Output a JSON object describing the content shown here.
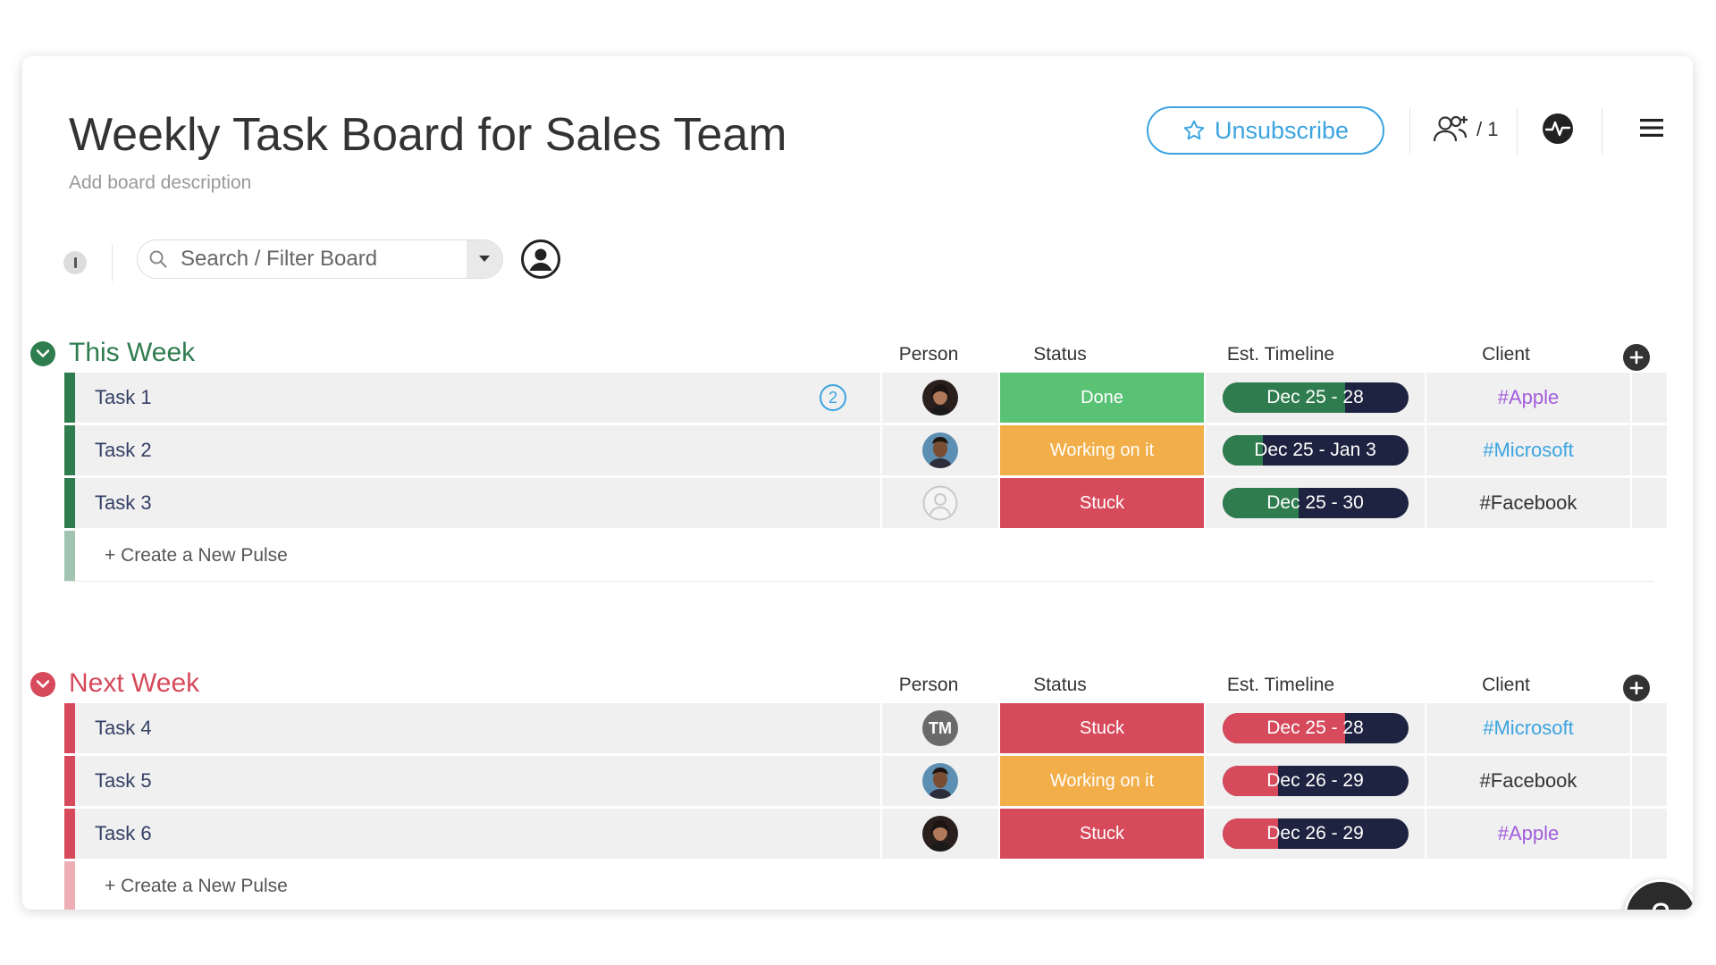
{
  "board": {
    "title": "Weekly Task Board for Sales Team",
    "description": "Add board description",
    "unsubscribe_label": "Unsubscribe",
    "members_count": "/ 1"
  },
  "toolbar": {
    "search_placeholder": "Search / Filter Board"
  },
  "columns": {
    "person": "Person",
    "status": "Status",
    "timeline": "Est. Timeline",
    "client": "Client"
  },
  "groups": [
    {
      "title": "This Week",
      "color": "#2f7d4f",
      "create_label": "+ Create a New Pulse",
      "rows": [
        {
          "name": "Task 1",
          "updates": "2",
          "person": "photo-woman",
          "status": "Done",
          "status_color": "#5ac274",
          "timeline": "Dec 25 - 28",
          "timeline_progress": 0.66,
          "client": "#Apple",
          "client_color": "#a25ddc"
        },
        {
          "name": "Task 2",
          "updates": "",
          "person": "photo-man",
          "status": "Working on it",
          "status_color": "#f2ae49",
          "timeline": "Dec 25 - Jan 3",
          "timeline_progress": 0.22,
          "client": "#Microsoft",
          "client_color": "#3ba4e0"
        },
        {
          "name": "Task 3",
          "updates": "",
          "person": "empty",
          "status": "Stuck",
          "status_color": "#d64a5c",
          "timeline": "Dec 25 - 30",
          "timeline_progress": 0.41,
          "client": "#Facebook",
          "client_color": "#333333"
        }
      ]
    },
    {
      "title": "Next Week",
      "color": "#d64a5c",
      "create_label": "+ Create a New Pulse",
      "rows": [
        {
          "name": "Task 4",
          "updates": "",
          "person": "initials",
          "initials": "TM",
          "status": "Stuck",
          "status_color": "#d64a5c",
          "timeline": "Dec 25 - 28",
          "timeline_progress": 0.66,
          "client": "#Microsoft",
          "client_color": "#3ba4e0"
        },
        {
          "name": "Task 5",
          "updates": "",
          "person": "photo-man",
          "status": "Working on it",
          "status_color": "#f2ae49",
          "timeline": "Dec 26 - 29",
          "timeline_progress": 0.3,
          "client": "#Facebook",
          "client_color": "#333333"
        },
        {
          "name": "Task 6",
          "updates": "",
          "person": "photo-woman",
          "status": "Stuck",
          "status_color": "#d64a5c",
          "timeline": "Dec 26 - 29",
          "timeline_progress": 0.3,
          "client": "#Apple",
          "client_color": "#a25ddc"
        }
      ]
    }
  ],
  "help_label": "?"
}
